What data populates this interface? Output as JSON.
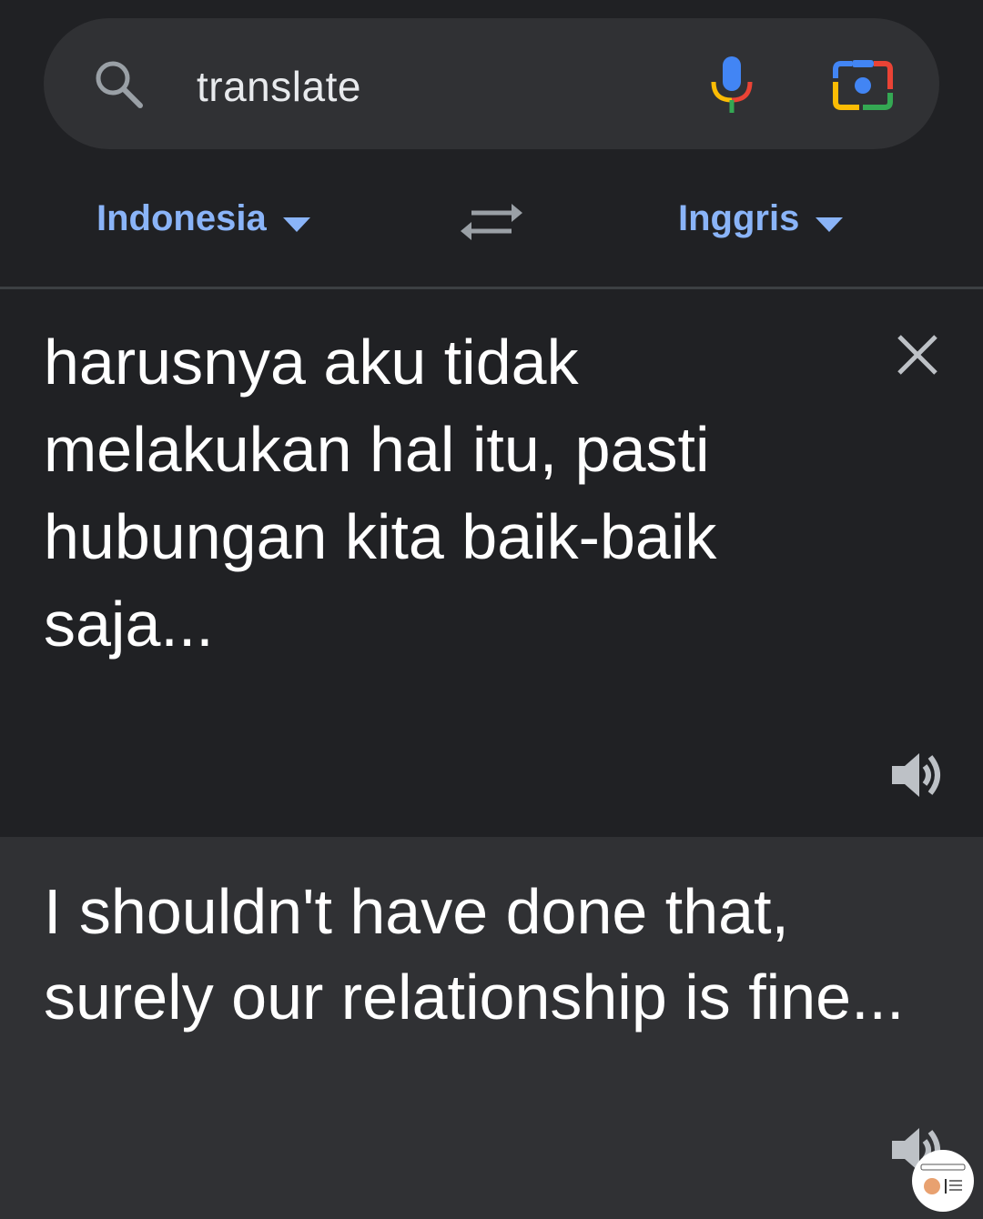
{
  "search": {
    "query": "translate",
    "icons": {
      "search": "search-icon",
      "voice": "mic-icon",
      "lens": "camera-lens-icon"
    },
    "colors": {
      "blue": "#4285f4",
      "red": "#ea4335",
      "yellow": "#fbbc04",
      "green": "#34a853"
    }
  },
  "languages": {
    "source": "Indonesia",
    "target": "Inggris",
    "swap_icon": "swap-arrows-icon",
    "accent": "#8ab4f8"
  },
  "source_panel": {
    "text": "harusnya aku tidak melakukan hal itu, pasti hubungan kita baik-baik saja...",
    "clear_icon": "close-icon",
    "speaker_icon": "speaker-icon"
  },
  "result_panel": {
    "text": "I shouldn't have done that, surely our relationship is fine...",
    "speaker_icon": "speaker-icon"
  }
}
